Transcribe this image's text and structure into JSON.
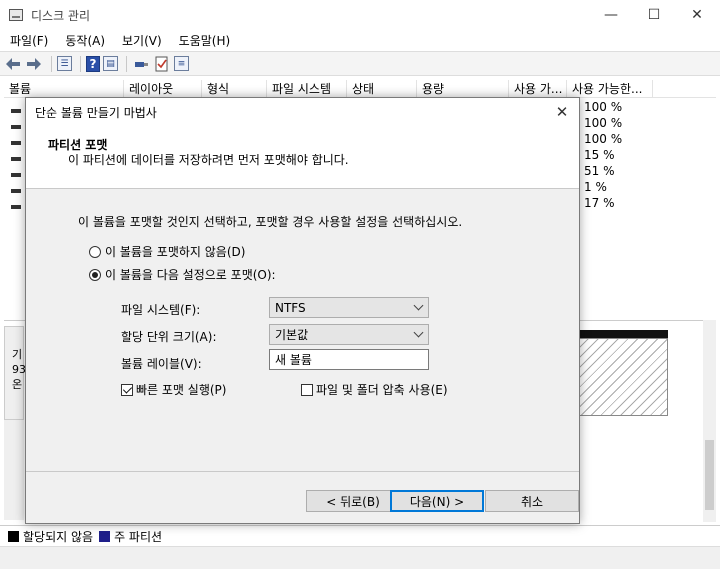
{
  "window": {
    "title": "디스크 관리",
    "controls": {
      "minimize": "—",
      "maximize": "☐",
      "close": "✕"
    }
  },
  "menu": [
    "파일(F)",
    "동작(A)",
    "보기(V)",
    "도움말(H)"
  ],
  "toolbar": {
    "icons": [
      "back-arrow-icon",
      "forward-arrow-icon",
      "list-view-icon",
      "help-icon",
      "panel-icon",
      "connect-icon",
      "check-icon",
      "properties-icon"
    ],
    "help_glyph": "?"
  },
  "volume_table": {
    "columns": [
      "볼륨",
      "레이아웃",
      "형식",
      "파일 시스템",
      "상태",
      "용량",
      "사용 가...",
      "사용 가능한..."
    ],
    "free_percent": [
      "100 %",
      "100 %",
      "100 %",
      "15 %",
      "51 %",
      "1 %",
      "17 %"
    ]
  },
  "disk_panel": {
    "left_fragments": [
      "기",
      "93",
      "온"
    ]
  },
  "legend": [
    {
      "label": "할당되지 않음",
      "color": "#000000"
    },
    {
      "label": "주 파티션",
      "color": "#1f1f8a"
    }
  ],
  "wizard": {
    "title": "단순 볼륨 만들기 마법사",
    "close_label": "✕",
    "header_title": "파티션 포맷",
    "header_subtitle": "이 파티션에 데이터를 저장하려면 먼저 포맷해야 합니다.",
    "instruction": "이 볼륨을 포맷할 것인지 선택하고, 포맷할 경우 사용할 설정을 선택하십시오.",
    "option_no_format": "이 볼륨을 포맷하지 않음(D)",
    "option_format": "이 볼륨을 다음 설정으로 포맷(O):",
    "selected_option": "format",
    "file_system_label": "파일 시스템(F):",
    "file_system_value": "NTFS",
    "alloc_unit_label": "할당 단위 크기(A):",
    "alloc_unit_value": "기본값",
    "volume_label_label": "볼륨 레이블(V):",
    "volume_label_value": "새 볼륨",
    "quick_format_label": "빠른 포맷 실행(P)",
    "quick_format_checked": true,
    "compression_label": "파일 및 폴더 압축 사용(E)",
    "compression_checked": false,
    "back_button": "< 뒤로(B)",
    "next_button": "다음(N) >",
    "cancel_button": "취소"
  }
}
